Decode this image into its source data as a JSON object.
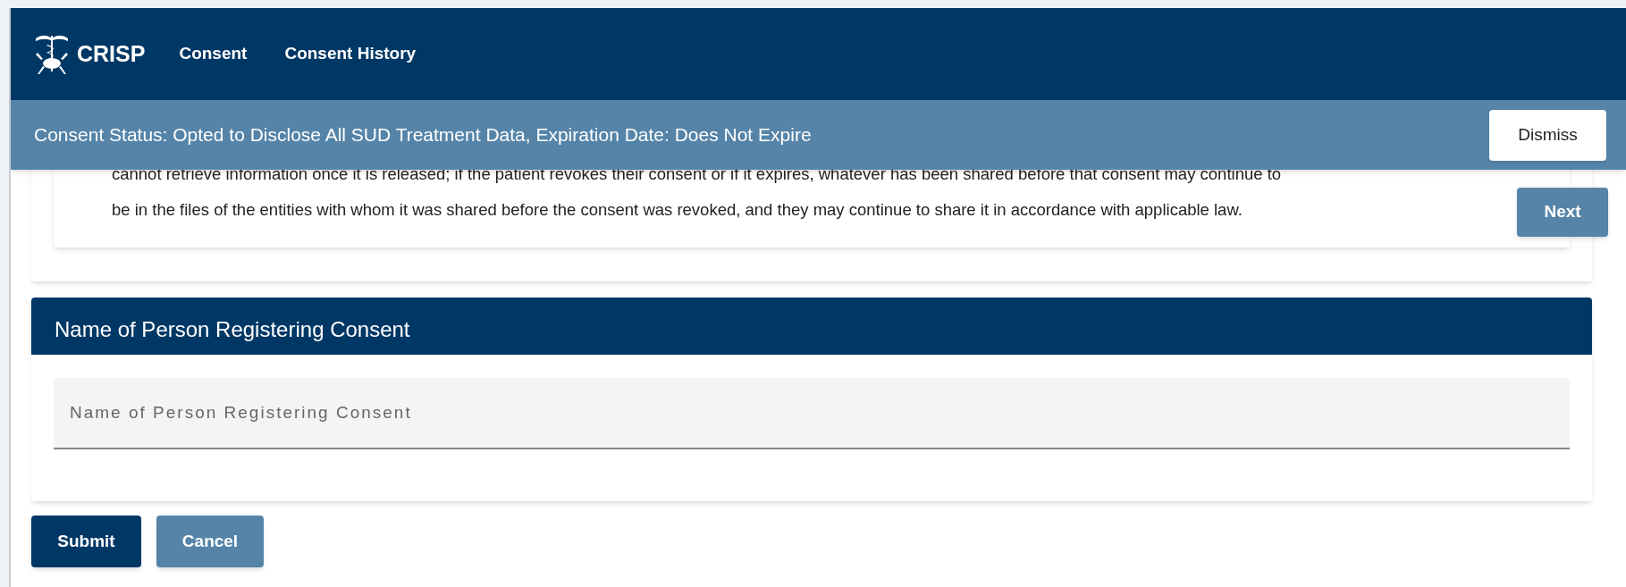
{
  "header": {
    "brand": "CRISP",
    "nav": [
      {
        "label": "Consent",
        "selected": false
      },
      {
        "label": "Consent History",
        "selected": false
      }
    ]
  },
  "status_banner": {
    "text": "Consent Status: Opted to Disclose All SUD Treatment Data, Expiration Date: Does Not Expire",
    "dismiss": "Dismiss"
  },
  "disclosure": {
    "lines": [
      "cannot retrieve information once it is released; if the patient revokes their consent or if it expires, whatever has been shared before that consent may continue to",
      "be in the files of the entities with whom it was shared before the consent was revoked, and they may continue to share it in accordance with applicable law."
    ],
    "next": "Next"
  },
  "registrant": {
    "title": "Name of Person Registering Consent",
    "placeholder": "Name of Person Registering Consent"
  },
  "actions": [
    "Submit",
    "Cancel"
  ]
}
